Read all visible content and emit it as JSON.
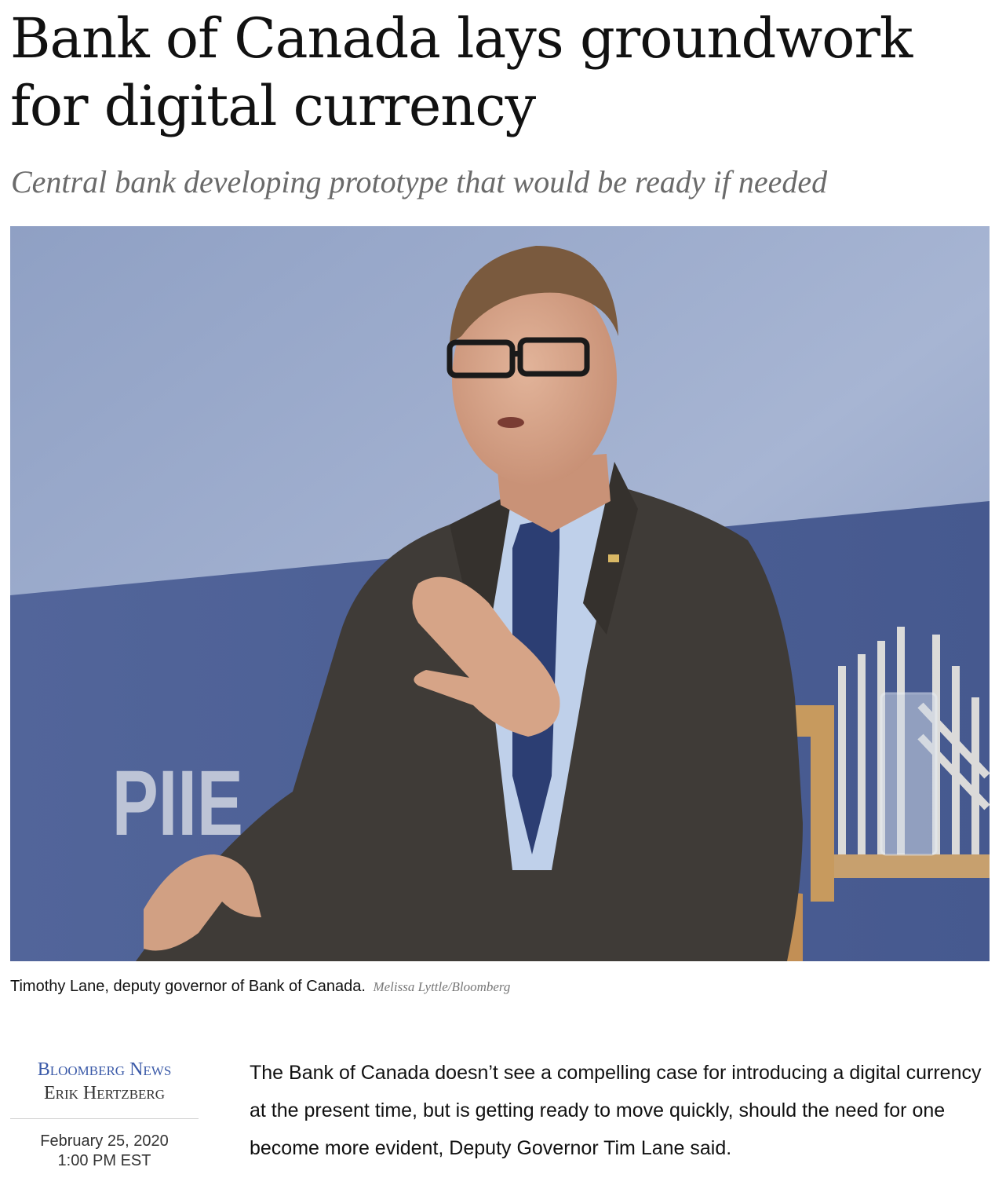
{
  "article": {
    "headline": "Bank of Canada lays groundwork for digital currency",
    "dek": "Central bank developing prototype that would be ready if needed",
    "photo": {
      "backdrop_text": "PIIE",
      "caption": "Timothy Lane, deputy governor of Bank of Canada.",
      "credit": "Melissa Lyttle/Bloomberg"
    },
    "byline": {
      "source": "Bloomberg News",
      "author": "Erik Hertzberg",
      "date": "February 25, 2020",
      "time": "1:00 PM EST"
    },
    "body": [
      "The Bank of Canada doesn’t see a compelling case for introducing a digital currency at the present time, but is getting ready to move quickly, should the need for one become more evident, Deputy Governor Tim Lane said."
    ]
  },
  "colors": {
    "source_link": "#3b5aa8",
    "dek": "#6a6a6a",
    "credit": "#777777"
  }
}
